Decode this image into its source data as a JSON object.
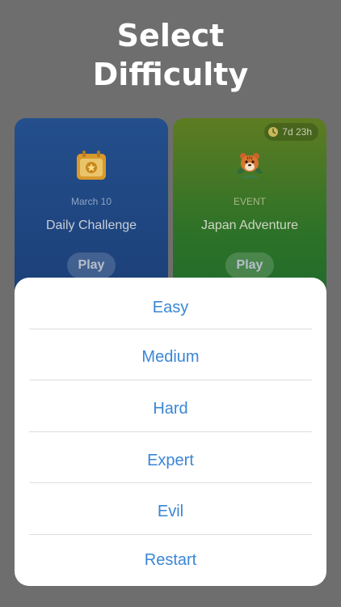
{
  "header": {
    "title_line1": "Select",
    "title_line2": "Difficulty"
  },
  "cards": {
    "daily": {
      "subtitle": "March 10",
      "title": "Daily Challenge",
      "play_label": "Play",
      "icon": "calendar-star-icon"
    },
    "event": {
      "subtitle": "EVENT",
      "title": "Japan Adventure",
      "play_label": "Play",
      "badge": "7d 23h",
      "icon": "tiger-mascot-icon"
    }
  },
  "menu": {
    "options": [
      {
        "label": "Easy"
      },
      {
        "label": "Medium"
      },
      {
        "label": "Hard"
      },
      {
        "label": "Expert"
      },
      {
        "label": "Evil"
      },
      {
        "label": "Restart"
      }
    ]
  },
  "colors": {
    "overlay": "#6e6e6e",
    "option_text": "#3a86d6",
    "sheet_background": "#ffffff"
  }
}
